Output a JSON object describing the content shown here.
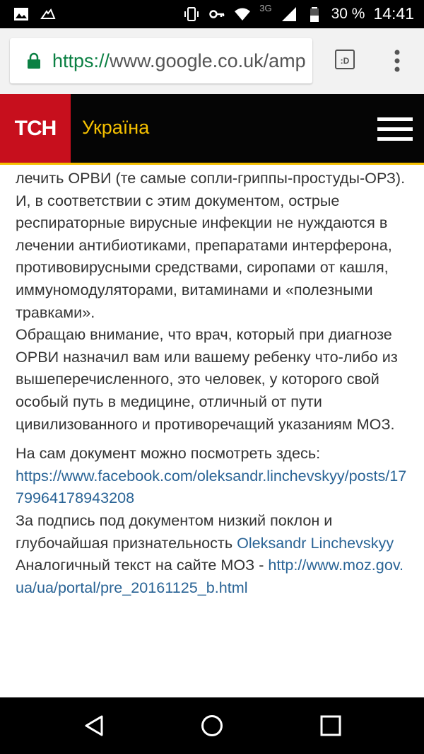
{
  "status_bar": {
    "battery": "30 %",
    "time": "14:41",
    "network": "3G",
    "icons": [
      "image-icon",
      "app-notification-icon",
      "vibrate-icon",
      "key-icon",
      "wifi-icon",
      "signal-icon",
      "battery-icon"
    ]
  },
  "browser": {
    "url_scheme": "https://",
    "url_rest": "www.google.co.uk/amp",
    "tabs_label": ":D",
    "accent": "#0b8043"
  },
  "site_header": {
    "logo": "ТСН",
    "section": "Україна",
    "logo_color": "#c70f1d",
    "accent": "#f5c000"
  },
  "article": {
    "p1": "лечить ОРВИ (те самые сопли-гриппы-простуды-ОРЗ).",
    "p2": "И, в соответствии с этим документом, острые респираторные вирусные инфекции не нуждаются в лечении антибиотиками, препаратами интерферона, противовирусными средствами, сиропами от кашля, иммуномодуляторами, витаминами и «полезными травками».",
    "p3": "Обращаю внимание, что врач, который при диагнозе ОРВИ назначил вам или вашему ребенку что-либо из вышеперечисленного, это человек, у которого свой особый путь в медицине, отличный от пути цивилизованного и противоречащий указаниям МОЗ.",
    "p4_text": "На сам документ можно посмотреть здесь:",
    "p4_link": "https://www.facebook.com/oleksandr.linchevskyy/posts/1779964178943208",
    "p5_text": "За подпись под документом низкий поклон и глубочайшая признательность ",
    "p5_link": "Oleksandr Linchevskyy",
    "p6_text": "Аналогичный текст на сайте МОЗ - ",
    "p6_link": "http://www.moz.gov.ua/ua/portal/pre_20161125_b.html",
    "link_color": "#2a6496"
  },
  "nav_bar": {
    "icons": [
      "back-icon",
      "home-icon",
      "recents-icon"
    ]
  }
}
